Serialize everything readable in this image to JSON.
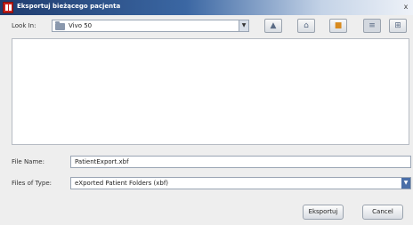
{
  "window": {
    "title": "Eksportuj bieżącego pacjenta",
    "close_label": "x"
  },
  "look_in": {
    "label": "Look In:",
    "value": "Vivo 50"
  },
  "toolbar": {
    "buttons": [
      {
        "name": "up-one-level",
        "icon": "folder-up-icon",
        "glyph": "▲"
      },
      {
        "name": "home",
        "icon": "home-icon",
        "glyph": "⌂"
      },
      {
        "name": "new-folder",
        "icon": "new-folder-icon",
        "glyph": "■"
      },
      {
        "name": "list-view",
        "icon": "list-view-icon",
        "glyph": "≡"
      },
      {
        "name": "details-view",
        "icon": "details-view-icon",
        "glyph": "⊞"
      }
    ]
  },
  "file_list": {
    "items": []
  },
  "file_name": {
    "label": "File Name:",
    "value": "PatientExport.xbf"
  },
  "files_of_type": {
    "label": "Files of Type:",
    "value": "eXported Patient Folders (xbf)"
  },
  "buttons": {
    "export_label": "Eksportuj",
    "cancel_label": "Cancel"
  }
}
